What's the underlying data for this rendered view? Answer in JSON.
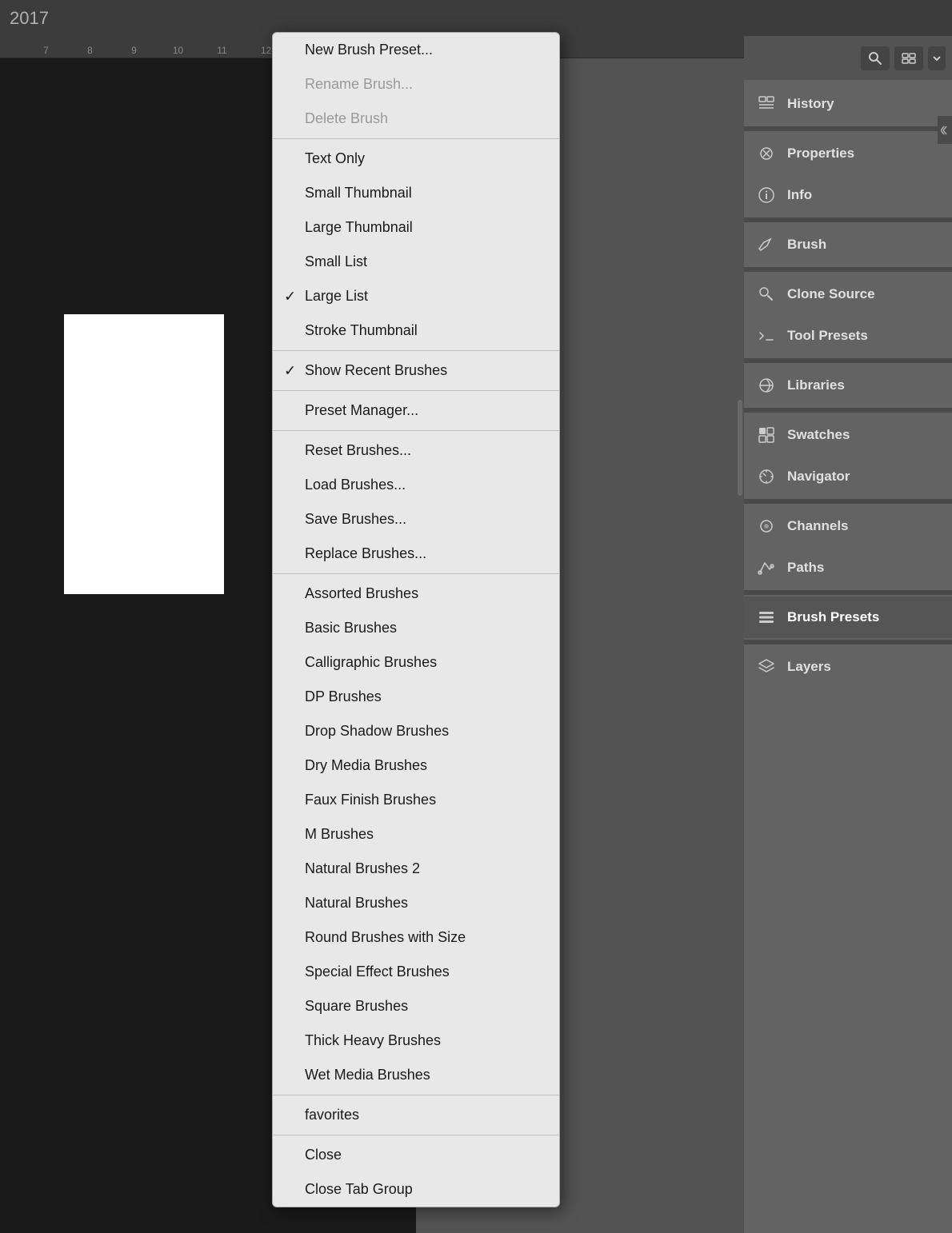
{
  "titlebar": {
    "year": "2017"
  },
  "ruler": {
    "marks": [
      "7",
      "8",
      "9",
      "10",
      "11",
      "12"
    ]
  },
  "contextMenu": {
    "items": [
      {
        "id": "new-brush-preset",
        "label": "New Brush Preset...",
        "disabled": false,
        "checked": false,
        "separator_after": false
      },
      {
        "id": "rename-brush",
        "label": "Rename Brush...",
        "disabled": true,
        "checked": false,
        "separator_after": false
      },
      {
        "id": "delete-brush",
        "label": "Delete Brush",
        "disabled": true,
        "checked": false,
        "separator_after": true
      },
      {
        "id": "text-only",
        "label": "Text Only",
        "disabled": false,
        "checked": false,
        "separator_after": false
      },
      {
        "id": "small-thumbnail",
        "label": "Small Thumbnail",
        "disabled": false,
        "checked": false,
        "separator_after": false
      },
      {
        "id": "large-thumbnail",
        "label": "Large Thumbnail",
        "disabled": false,
        "checked": false,
        "separator_after": false
      },
      {
        "id": "small-list",
        "label": "Small List",
        "disabled": false,
        "checked": false,
        "separator_after": false
      },
      {
        "id": "large-list",
        "label": "Large List",
        "disabled": false,
        "checked": true,
        "separator_after": false
      },
      {
        "id": "stroke-thumbnail",
        "label": "Stroke Thumbnail",
        "disabled": false,
        "checked": false,
        "separator_after": true
      },
      {
        "id": "show-recent-brushes",
        "label": "Show Recent Brushes",
        "disabled": false,
        "checked": true,
        "separator_after": true
      },
      {
        "id": "preset-manager",
        "label": "Preset Manager...",
        "disabled": false,
        "checked": false,
        "separator_after": true
      },
      {
        "id": "reset-brushes",
        "label": "Reset Brushes...",
        "disabled": false,
        "checked": false,
        "separator_after": false
      },
      {
        "id": "load-brushes",
        "label": "Load Brushes...",
        "disabled": false,
        "checked": false,
        "separator_after": false
      },
      {
        "id": "save-brushes",
        "label": "Save Brushes...",
        "disabled": false,
        "checked": false,
        "separator_after": false
      },
      {
        "id": "replace-brushes",
        "label": "Replace Brushes...",
        "disabled": false,
        "checked": false,
        "separator_after": true
      },
      {
        "id": "assorted-brushes",
        "label": "Assorted Brushes",
        "disabled": false,
        "checked": false,
        "separator_after": false
      },
      {
        "id": "basic-brushes",
        "label": "Basic Brushes",
        "disabled": false,
        "checked": false,
        "separator_after": false
      },
      {
        "id": "calligraphic-brushes",
        "label": "Calligraphic Brushes",
        "disabled": false,
        "checked": false,
        "separator_after": false
      },
      {
        "id": "dp-brushes",
        "label": "DP Brushes",
        "disabled": false,
        "checked": false,
        "separator_after": false
      },
      {
        "id": "drop-shadow-brushes",
        "label": "Drop Shadow Brushes",
        "disabled": false,
        "checked": false,
        "separator_after": false
      },
      {
        "id": "dry-media-brushes",
        "label": "Dry Media Brushes",
        "disabled": false,
        "checked": false,
        "separator_after": false
      },
      {
        "id": "faux-finish-brushes",
        "label": "Faux Finish Brushes",
        "disabled": false,
        "checked": false,
        "separator_after": false
      },
      {
        "id": "m-brushes",
        "label": "M Brushes",
        "disabled": false,
        "checked": false,
        "separator_after": false
      },
      {
        "id": "natural-brushes-2",
        "label": "Natural Brushes 2",
        "disabled": false,
        "checked": false,
        "separator_after": false
      },
      {
        "id": "natural-brushes",
        "label": "Natural Brushes",
        "disabled": false,
        "checked": false,
        "separator_after": false
      },
      {
        "id": "round-brushes-with-size",
        "label": "Round Brushes with Size",
        "disabled": false,
        "checked": false,
        "separator_after": false
      },
      {
        "id": "special-effect-brushes",
        "label": "Special Effect Brushes",
        "disabled": false,
        "checked": false,
        "separator_after": false
      },
      {
        "id": "square-brushes",
        "label": "Square Brushes",
        "disabled": false,
        "checked": false,
        "separator_after": false
      },
      {
        "id": "thick-heavy-brushes",
        "label": "Thick Heavy Brushes",
        "disabled": false,
        "checked": false,
        "separator_after": false
      },
      {
        "id": "wet-media-brushes",
        "label": "Wet Media Brushes",
        "disabled": false,
        "checked": false,
        "separator_after": true
      },
      {
        "id": "favorites",
        "label": "favorites",
        "disabled": false,
        "checked": false,
        "separator_after": true
      },
      {
        "id": "close",
        "label": "Close",
        "disabled": false,
        "checked": false,
        "separator_after": false
      },
      {
        "id": "close-tab-group",
        "label": "Close Tab Group",
        "disabled": false,
        "checked": false,
        "separator_after": false
      }
    ]
  },
  "rightPanel": {
    "panels": [
      {
        "id": "history",
        "label": "History",
        "active": false,
        "icon": "history"
      },
      {
        "id": "properties",
        "label": "Properties",
        "active": false,
        "icon": "properties"
      },
      {
        "id": "info",
        "label": "Info",
        "active": false,
        "icon": "info"
      },
      {
        "id": "brush",
        "label": "Brush",
        "active": false,
        "icon": "brush"
      },
      {
        "id": "clone-source",
        "label": "Clone Source",
        "active": false,
        "icon": "clone"
      },
      {
        "id": "tool-presets",
        "label": "Tool Presets",
        "active": false,
        "icon": "tool-presets"
      },
      {
        "id": "libraries",
        "label": "Libraries",
        "active": false,
        "icon": "libraries"
      },
      {
        "id": "swatches",
        "label": "Swatches",
        "active": false,
        "icon": "swatches"
      },
      {
        "id": "navigator",
        "label": "Navigator",
        "active": false,
        "icon": "navigator"
      },
      {
        "id": "channels",
        "label": "Channels",
        "active": false,
        "icon": "channels"
      },
      {
        "id": "paths",
        "label": "Paths",
        "active": false,
        "icon": "paths"
      },
      {
        "id": "brush-presets",
        "label": "Brush Presets",
        "active": true,
        "icon": "brush-presets"
      },
      {
        "id": "layers",
        "label": "Layers",
        "active": false,
        "icon": "layers"
      }
    ]
  }
}
